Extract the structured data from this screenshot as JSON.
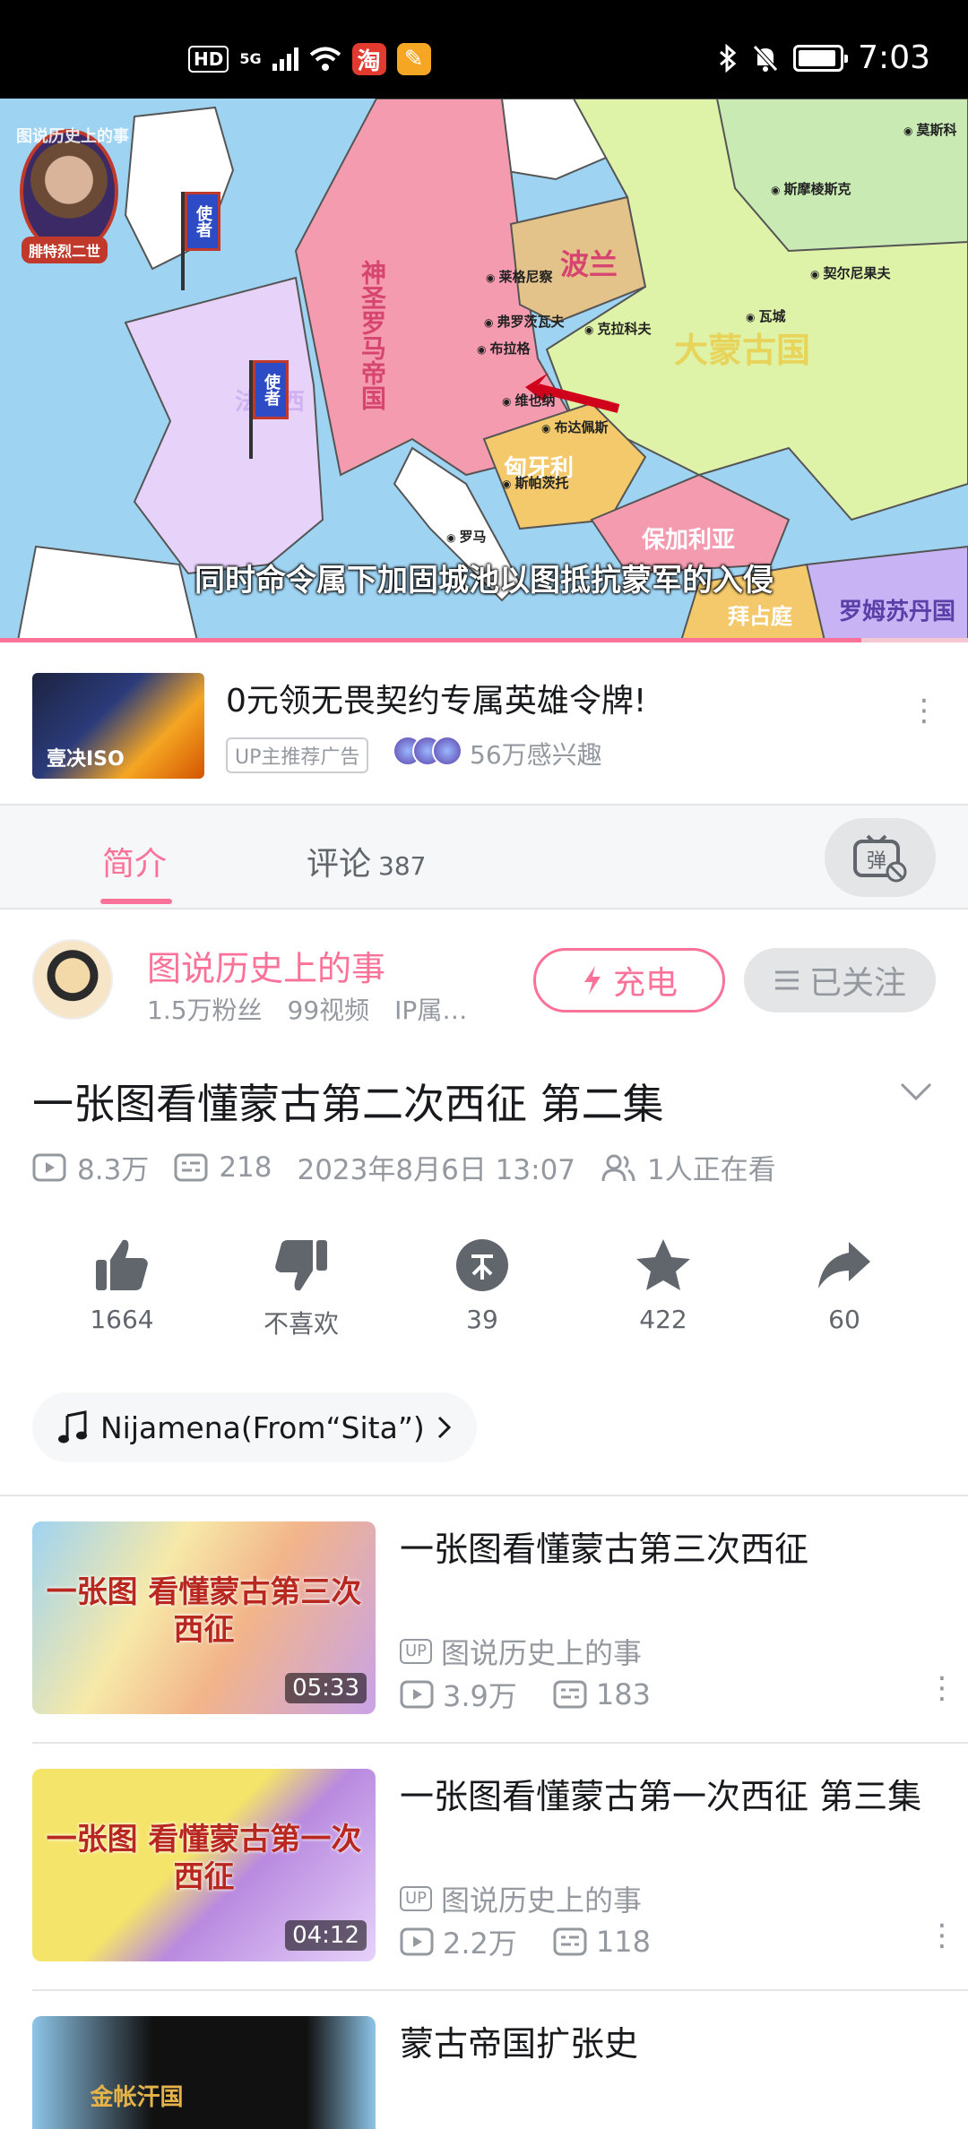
{
  "status_bar": {
    "time": "7:03",
    "hd": "HD",
    "network": "5G",
    "app1_glyph": "淘",
    "app2_glyph": "✎"
  },
  "player": {
    "watermark": "图说历史上的事 bilibili",
    "portrait_caption": "腓特烈二世",
    "flag_text": "使者",
    "subtitle": "同时命令属下加固城池以图抵抗蒙军的入侵",
    "progress": 0.89,
    "map_labels": {
      "hre": "神圣罗马帝国",
      "poland": "波兰",
      "mongol": "大蒙古国",
      "hungary": "匈牙利",
      "bulgaria": "保加利亚",
      "byzantine": "拜占庭",
      "rum": "罗姆苏丹国",
      "france": "法兰西"
    },
    "cities": [
      "莫斯科",
      "斯摩棱斯克",
      "契尔尼果夫",
      "莱格尼察",
      "弗罗茨瓦夫",
      "克拉科夫",
      "布拉格",
      "瓦城",
      "维也纳",
      "布达佩斯",
      "斯帕茨托",
      "罗马"
    ]
  },
  "ad": {
    "thumb_text": "壹决ISO",
    "title": "0元领无畏契约专属英雄令牌!",
    "tag": "UP主推荐广告",
    "interest": "56万感兴趣"
  },
  "tabs": {
    "intro": "简介",
    "comments": "评论",
    "comment_count": "387",
    "danmaku_glyph": "弹"
  },
  "uploader": {
    "name": "图说历史上的事",
    "fans": "1.5万粉丝",
    "videos": "99视频",
    "ip": "IP属…",
    "charge_label": "充电",
    "follow_label": "已关注"
  },
  "video": {
    "title": "一张图看懂蒙古第二次西征 第二集",
    "views": "8.3万",
    "danmaku": "218",
    "date": "2023年8月6日 13:07",
    "watching": "1人正在看"
  },
  "actions": {
    "like": "1664",
    "dislike": "不喜欢",
    "coin": "39",
    "favorite": "422",
    "share": "60"
  },
  "music": {
    "label": "Nijamena(From“Sita”)"
  },
  "related": [
    {
      "title": "一张图看懂蒙古第三次西征",
      "thumb_text": "一张图 看懂蒙古第三次西征",
      "duration": "05:33",
      "up": "图说历史上的事",
      "views": "3.9万",
      "danmaku": "183"
    },
    {
      "title": "一张图看懂蒙古第一次西征 第三集",
      "thumb_text": "一张图 看懂蒙古第一次西征",
      "duration": "04:12",
      "up": "图说历史上的事",
      "views": "2.2万",
      "danmaku": "118"
    },
    {
      "title": "蒙古帝国扩张史",
      "thumb_text": "金帐汗国"
    }
  ],
  "colors": {
    "brand_pink": "#fb7299",
    "text_primary": "#18191c",
    "text_secondary": "#9499a0"
  }
}
